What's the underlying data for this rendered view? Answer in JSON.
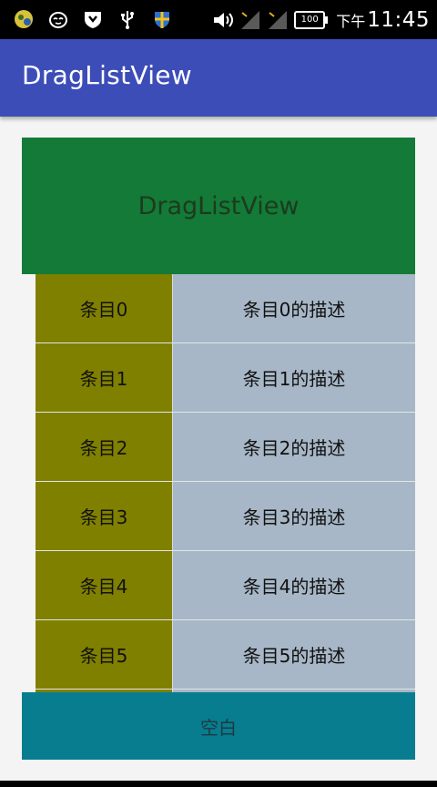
{
  "status_bar": {
    "icons_left": [
      "game-controller-icon",
      "cat-face-icon",
      "shield-download-icon",
      "usb-icon",
      "shield-icon"
    ],
    "icons_right": [
      "volume-icon",
      "signal-1-icon",
      "signal-2-icon"
    ],
    "battery": "100",
    "ampm": "下午",
    "time": "11:45"
  },
  "app_bar": {
    "title": "DragListView",
    "color": "#3c4db8"
  },
  "header": {
    "text": "DragListView",
    "color": "#137a37"
  },
  "list": {
    "items": [
      {
        "label": "条目0",
        "description": "条目0的描述"
      },
      {
        "label": "条目1",
        "description": "条目1的描述"
      },
      {
        "label": "条目2",
        "description": "条目2的描述"
      },
      {
        "label": "条目3",
        "description": "条目3的描述"
      },
      {
        "label": "条目4",
        "description": "条目4的描述"
      },
      {
        "label": "条目5",
        "description": "条目5的描述"
      }
    ],
    "left_color": "#808000",
    "right_color": "#a7b7c7"
  },
  "footer": {
    "text": "空白",
    "color": "#077d8f"
  }
}
